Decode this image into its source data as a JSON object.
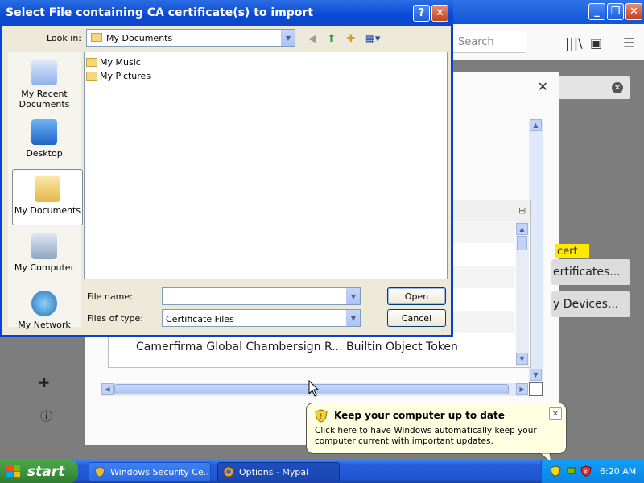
{
  "file_dialog": {
    "title": "Select File containing CA certificate(s) to import",
    "help_button": "?",
    "close_button": "✕",
    "look_in_label": "Look in:",
    "look_in_value": "My Documents",
    "places": [
      {
        "label": "My Recent Documents",
        "icon": "recent-documents-icon"
      },
      {
        "label": "Desktop",
        "icon": "desktop-icon"
      },
      {
        "label": "My Documents",
        "icon": "my-documents-icon"
      },
      {
        "label": "My Computer",
        "icon": "my-computer-icon"
      },
      {
        "label": "My Network",
        "icon": "my-network-icon"
      }
    ],
    "files": [
      "My Music",
      "My Pictures"
    ],
    "file_name_label": "File name:",
    "file_name_value": "",
    "files_of_type_label": "Files of type:",
    "files_of_type_value": "Certificate Files",
    "open_button": "Open",
    "cancel_button": "Cancel"
  },
  "browser": {
    "search_placeholder": "Search",
    "cert_manager": {
      "close": "✕",
      "visible_row": "Camerfirma Global Chambersign R... Builtin Object Token",
      "badge": "cert",
      "side_buttons": [
        "ertificates...",
        "y Devices..."
      ]
    }
  },
  "balloon": {
    "title": "Keep your computer up to date",
    "body": "Click here to have Windows automatically keep your computer current with important updates."
  },
  "taskbar": {
    "start_label": "start",
    "tasks": [
      {
        "label": "Windows Security Ce...",
        "icon": "security-shield-icon",
        "active": false
      },
      {
        "label": "Options - Mypal",
        "icon": "mypal-icon",
        "active": true
      }
    ],
    "clock": "6:20 AM"
  },
  "colors": {
    "xp_blue": "#0a4ad4",
    "taskbar_blue": "#245edb",
    "start_green": "#3b8f3b",
    "balloon_bg": "#ffffe1",
    "badge_yellow": "#ffe900"
  }
}
